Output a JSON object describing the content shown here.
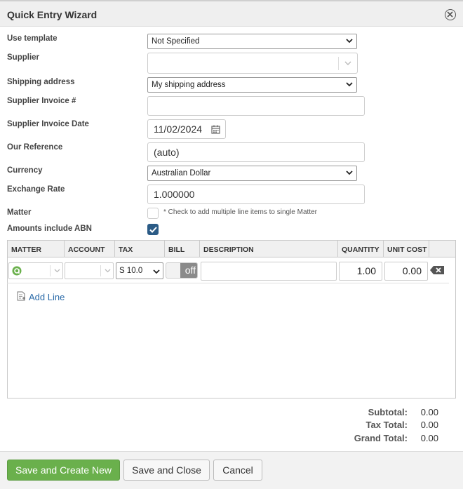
{
  "dialog": {
    "title": "Quick Entry Wizard",
    "close_icon": "close-circle-icon"
  },
  "form": {
    "use_template": {
      "label": "Use template",
      "value": "Not Specified"
    },
    "supplier": {
      "label": "Supplier",
      "value": ""
    },
    "shipping_address": {
      "label": "Shipping address",
      "value": "My shipping address"
    },
    "supplier_invoice_no": {
      "label": "Supplier Invoice #",
      "value": ""
    },
    "supplier_invoice_date": {
      "label": "Supplier Invoice Date",
      "value": "11/02/2024"
    },
    "our_reference": {
      "label": "Our Reference",
      "value": "(auto)"
    },
    "currency": {
      "label": "Currency",
      "value": "Australian Dollar"
    },
    "exchange_rate": {
      "label": "Exchange Rate",
      "value": "1.000000"
    },
    "matter": {
      "label": "Matter",
      "checked": false,
      "hint": "* Check to add multiple line items to single Matter"
    },
    "amounts_include_abn": {
      "label": "Amounts include ABN",
      "checked": true
    }
  },
  "grid": {
    "columns": [
      "MATTER",
      "ACCOUNT",
      "TAX",
      "BILL",
      "DESCRIPTION",
      "QUANTITY",
      "UNIT COST"
    ],
    "rows": [
      {
        "matter": "",
        "account": "",
        "tax": "S 10.0",
        "bill": "off",
        "description": "",
        "quantity": "1.00",
        "unit_cost": "0.00"
      }
    ],
    "add_line_label": "Add Line"
  },
  "totals": {
    "subtotal_label": "Subtotal:",
    "subtotal": "0.00",
    "tax_label": "Tax Total:",
    "tax": "0.00",
    "grand_label": "Grand Total:",
    "grand": "0.00"
  },
  "buttons": {
    "save_new": "Save and Create New",
    "save_close": "Save and Close",
    "cancel": "Cancel"
  },
  "colors": {
    "primary_button": "#6ab04c",
    "checkbox_checked": "#2b5b86",
    "link": "#2a6aa8"
  }
}
